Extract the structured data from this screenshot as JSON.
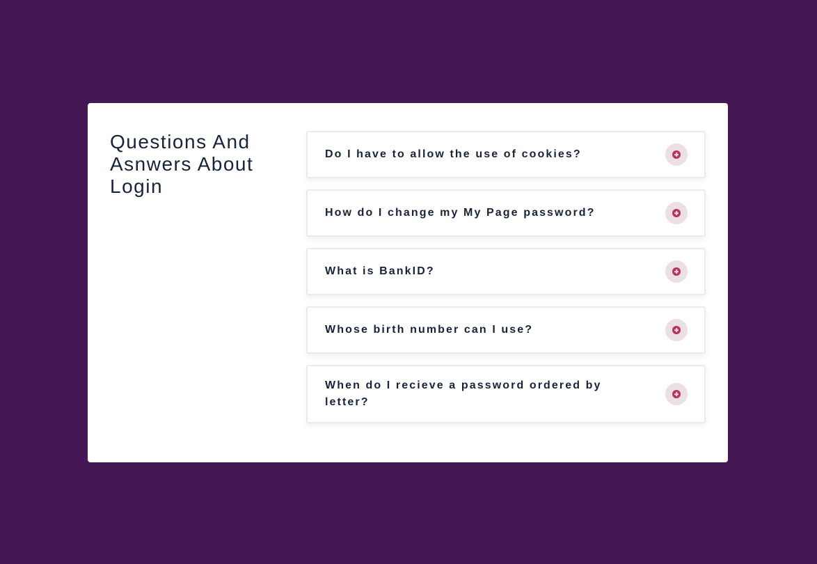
{
  "colors": {
    "background": "#461755",
    "card": "#ffffff",
    "text": "#17233a",
    "accent": "#b4345c",
    "toggle_bg": "#ecdfe6"
  },
  "page": {
    "title": "Questions And Asnwers About Login"
  },
  "faq": {
    "items": [
      {
        "question": "Do I have to allow the use of cookies?",
        "icon": "plus-circle-icon"
      },
      {
        "question": "How do I change my My Page password?",
        "icon": "plus-circle-icon"
      },
      {
        "question": "What is BankID?",
        "icon": "plus-circle-icon"
      },
      {
        "question": "Whose birth number can I use?",
        "icon": "plus-circle-icon"
      },
      {
        "question": "When do I recieve a password ordered by letter?",
        "icon": "plus-circle-icon"
      }
    ]
  }
}
